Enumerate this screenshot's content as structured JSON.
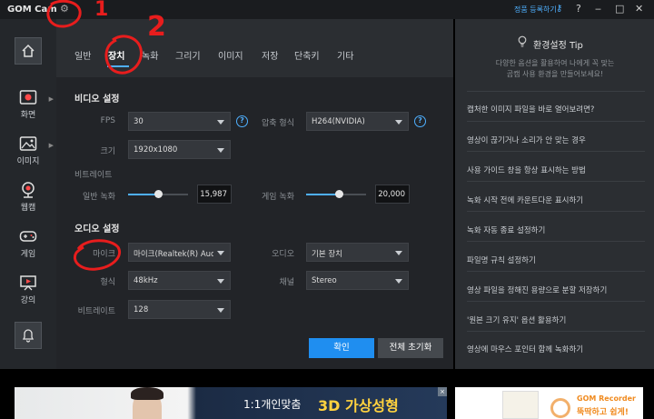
{
  "app": {
    "logo": "GOM Cam",
    "register_label": "정품 등록하기",
    "icons": {
      "settings": "gear-icon",
      "key": "key-icon",
      "help": "help-icon",
      "minimize": "minimize-icon",
      "maximize": "maximize-icon",
      "close": "close-icon"
    }
  },
  "sidebar": {
    "items": [
      {
        "label": "화면",
        "icon": "screen-record-icon",
        "has_arrow": true
      },
      {
        "label": "이미지",
        "icon": "image-icon",
        "has_arrow": true
      },
      {
        "label": "웹캠",
        "icon": "webcam-icon",
        "has_arrow": false
      },
      {
        "label": "게임",
        "icon": "gamepad-icon",
        "has_arrow": false
      },
      {
        "label": "강의",
        "icon": "lecture-icon",
        "has_arrow": false
      }
    ]
  },
  "tabs": [
    "일반",
    "장치",
    "녹화",
    "그리기",
    "이미지",
    "저장",
    "단축키",
    "기타"
  ],
  "active_tab": "장치",
  "video": {
    "title": "비디오 설정",
    "fps_label": "FPS",
    "fps_value": "30",
    "codec_label": "압축 형식",
    "codec_value": "H264(NVIDIA)",
    "size_label": "크기",
    "size_value": "1920x1080",
    "bitrate_label": "비트레이트",
    "normal_label": "일반 녹화",
    "normal_value": "15,987",
    "normal_level": 0.5,
    "game_label": "게임 녹화",
    "game_value": "20,000",
    "game_level": 0.55
  },
  "audio": {
    "title": "오디오 설정",
    "mic_label": "마이크",
    "mic_value": "마이크(Realtek(R) Aud",
    "audio_label": "오디오",
    "audio_value": "기본 장치",
    "format_label": "형식",
    "format_value": "48kHz",
    "channel_label": "채널",
    "channel_value": "Stereo",
    "bitrate_label": "비트레이트",
    "bitrate_value": "128"
  },
  "buttons": {
    "confirm": "확인",
    "reset": "전체 초기화"
  },
  "tips": {
    "title": "환경설정 Tip",
    "desc_line1": "다양한 옵션을 활용하여 나에게 꼭 맞는",
    "desc_line2": "곰캠 사용 환경을 만들어보세요!",
    "items": [
      "캡처한 이미지 파일을 바로 열어보려면?",
      "영상이 끊기거나 소리가 안 맞는 경우",
      "사용 가이드 창을 항상 표시하는 방법",
      "녹화 시작 전에 카운트다운 표시하기",
      "녹화 자동 종료 설정하기",
      "파일명 규칙 설정하기",
      "영상 파일을 정해진 용량으로 분할 저장하기",
      "'원본 크기 유지' 옵션 활용하기",
      "영상에 마우스 포인터 함께 녹화하기"
    ]
  },
  "ads": {
    "left_text1": "1:1개인맞춤",
    "left_text2": "3D 가상성형",
    "right_brand": "GOM Recorder",
    "right_slogan": "뚝딱하고 쉽게!"
  },
  "annotations": [
    "1",
    "2"
  ]
}
